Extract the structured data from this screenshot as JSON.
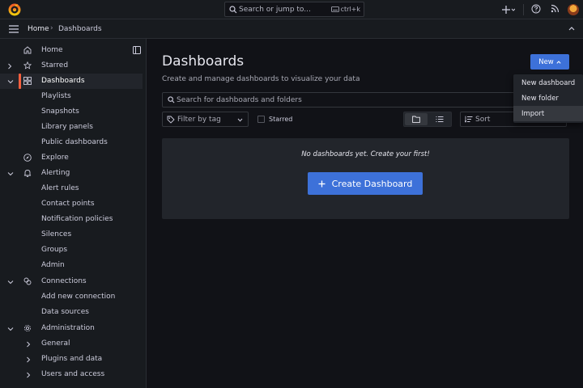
{
  "topbar": {
    "search_placeholder": "Search or jump to...",
    "shortcut": "ctrl+k"
  },
  "breadcrumb": {
    "home": "Home",
    "separator": "›",
    "current": "Dashboards"
  },
  "sidebar": {
    "items": [
      {
        "label": "Home"
      },
      {
        "label": "Starred"
      },
      {
        "label": "Dashboards"
      },
      {
        "label": "Playlists"
      },
      {
        "label": "Snapshots"
      },
      {
        "label": "Library panels"
      },
      {
        "label": "Public dashboards"
      },
      {
        "label": "Explore"
      },
      {
        "label": "Alerting"
      },
      {
        "label": "Alert rules"
      },
      {
        "label": "Contact points"
      },
      {
        "label": "Notification policies"
      },
      {
        "label": "Silences"
      },
      {
        "label": "Groups"
      },
      {
        "label": "Admin"
      },
      {
        "label": "Connections"
      },
      {
        "label": "Add new connection"
      },
      {
        "label": "Data sources"
      },
      {
        "label": "Administration"
      },
      {
        "label": "General"
      },
      {
        "label": "Plugins and data"
      },
      {
        "label": "Users and access"
      }
    ]
  },
  "main": {
    "title": "Dashboards",
    "subtitle": "Create and manage dashboards to visualize your data",
    "new_button": "New",
    "search_placeholder": "Search for dashboards and folders",
    "tag_filter_placeholder": "Filter by tag",
    "starred_label": "Starred",
    "sort_placeholder": "Sort",
    "empty_message": "No dashboards yet. Create your first!",
    "create_button": "Create Dashboard"
  },
  "new_menu": {
    "items": [
      "New dashboard",
      "New folder",
      "Import"
    ]
  },
  "colors": {
    "accent": "#3d71d9",
    "active_indicator": "#f55f3e",
    "background": "#111217",
    "panel": "#181b1f"
  }
}
